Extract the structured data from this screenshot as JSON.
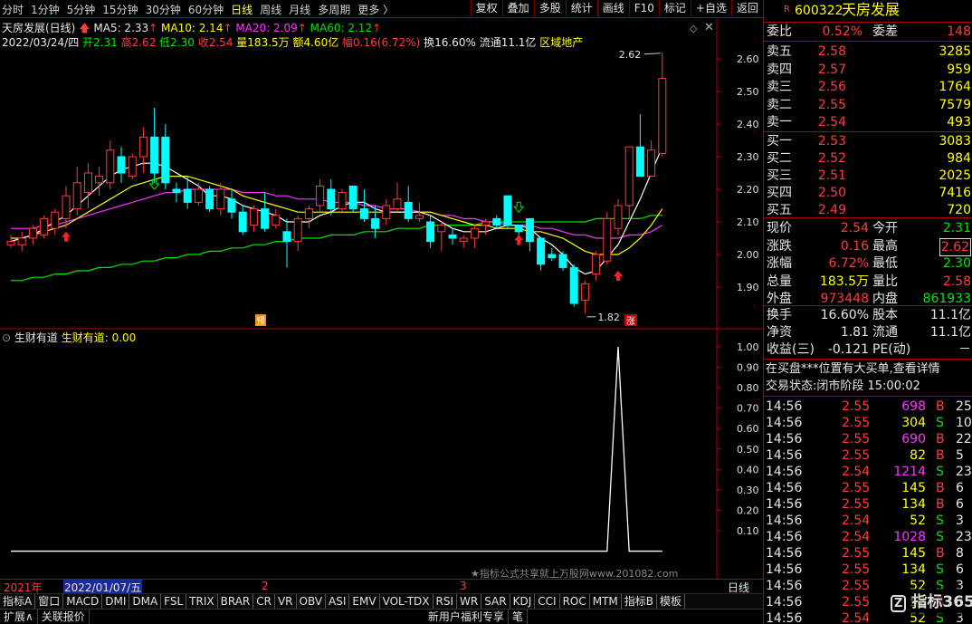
{
  "periods": [
    "分时",
    "1分钟",
    "5分钟",
    "15分钟",
    "30分钟",
    "60分钟",
    "日线",
    "周线",
    "月线",
    "多周期",
    "更多 〉"
  ],
  "toolbar": [
    "复权",
    "叠加",
    "多股",
    "统计",
    "画线",
    "F10",
    "标记",
    "+自选",
    "返回"
  ],
  "stock": {
    "code": "600322",
    "name": "天房发展",
    "badge": "R"
  },
  "legend": {
    "title": "天房发展(日线)",
    "ma5": "MA5: 2.33",
    "ma10": "MA10: 2.14",
    "ma20": "MA20: 2.09",
    "ma60": "MA60: 2.12"
  },
  "info_line": {
    "date": "2022/03/24/四",
    "open": "开2.31",
    "high": "高2.62",
    "low": "低2.30",
    "close": "收2.54",
    "vol": "量183.5万",
    "amt": "额4.60亿",
    "pct": "幅0.16(6.72%)",
    "turnover": "换16.60%",
    "float": "流通11.1亿",
    "sector": "区域地产"
  },
  "indicator": {
    "name": "生财有道",
    "value_label": "生财有道: 0.00",
    "expand_icon": "expand-icon"
  },
  "annotations": {
    "high": "2.62",
    "low": "1.82",
    "pre_mark": "预",
    "up_mark": "涨"
  },
  "time_axis": {
    "year": "2021年",
    "date": "2022/01/07/五",
    "m2": "2",
    "m3": "3",
    "period": "日线"
  },
  "watermark": "★指标公式共享就上万股网www.201082.com",
  "colors": {
    "up": "#ff3b3b",
    "down": "#00ffff",
    "ma5": "#ffffff",
    "ma10": "#ffff00",
    "ma20": "#ff33ff",
    "ma60": "#00e600",
    "grid": "#b00000"
  },
  "chart_data": [
    {
      "type": "candlestick",
      "title": "天房发展(日线)",
      "y_ticks": [
        1.9,
        2.0,
        2.1,
        2.2,
        2.3,
        2.4,
        2.5,
        2.6
      ],
      "ylim": [
        1.82,
        2.66
      ],
      "candles": [
        {
          "o": 2.03,
          "h": 2.06,
          "l": 2.02,
          "c": 2.04
        },
        {
          "o": 2.03,
          "h": 2.07,
          "l": 2.01,
          "c": 2.05
        },
        {
          "o": 2.05,
          "h": 2.09,
          "l": 2.03,
          "c": 2.08
        },
        {
          "o": 2.06,
          "h": 2.12,
          "l": 2.05,
          "c": 2.11
        },
        {
          "o": 2.08,
          "h": 2.14,
          "l": 2.06,
          "c": 2.13
        },
        {
          "o": 2.11,
          "h": 2.21,
          "l": 2.08,
          "c": 2.18
        },
        {
          "o": 2.14,
          "h": 2.27,
          "l": 2.12,
          "c": 2.22
        },
        {
          "o": 2.19,
          "h": 2.28,
          "l": 2.14,
          "c": 2.25
        },
        {
          "o": 2.22,
          "h": 2.27,
          "l": 2.18,
          "c": 2.24
        },
        {
          "o": 2.22,
          "h": 2.35,
          "l": 2.2,
          "c": 2.32
        },
        {
          "o": 2.3,
          "h": 2.33,
          "l": 2.22,
          "c": 2.25
        },
        {
          "o": 2.24,
          "h": 2.31,
          "l": 2.23,
          "c": 2.3
        },
        {
          "o": 2.3,
          "h": 2.39,
          "l": 2.25,
          "c": 2.36
        },
        {
          "o": 2.36,
          "h": 2.45,
          "l": 2.22,
          "c": 2.25
        },
        {
          "o": 2.36,
          "h": 2.4,
          "l": 2.2,
          "c": 2.22
        },
        {
          "o": 2.2,
          "h": 2.22,
          "l": 2.16,
          "c": 2.19
        },
        {
          "o": 2.2,
          "h": 2.24,
          "l": 2.14,
          "c": 2.16
        },
        {
          "o": 2.16,
          "h": 2.22,
          "l": 2.15,
          "c": 2.2
        },
        {
          "o": 2.2,
          "h": 2.21,
          "l": 2.13,
          "c": 2.14
        },
        {
          "o": 2.14,
          "h": 2.22,
          "l": 2.12,
          "c": 2.2
        },
        {
          "o": 2.17,
          "h": 2.2,
          "l": 2.11,
          "c": 2.13
        },
        {
          "o": 2.13,
          "h": 2.15,
          "l": 2.06,
          "c": 2.07
        },
        {
          "o": 2.09,
          "h": 2.15,
          "l": 2.07,
          "c": 2.14
        },
        {
          "o": 2.14,
          "h": 2.19,
          "l": 2.07,
          "c": 2.08
        },
        {
          "o": 2.09,
          "h": 2.14,
          "l": 2.08,
          "c": 2.12
        },
        {
          "o": 2.07,
          "h": 2.11,
          "l": 1.96,
          "c": 2.04
        },
        {
          "o": 2.04,
          "h": 2.12,
          "l": 2.01,
          "c": 2.11
        },
        {
          "o": 2.11,
          "h": 2.15,
          "l": 2.08,
          "c": 2.14
        },
        {
          "o": 2.15,
          "h": 2.23,
          "l": 2.13,
          "c": 2.21
        },
        {
          "o": 2.2,
          "h": 2.23,
          "l": 2.12,
          "c": 2.14
        },
        {
          "o": 2.14,
          "h": 2.2,
          "l": 2.13,
          "c": 2.19
        },
        {
          "o": 2.21,
          "h": 2.21,
          "l": 2.13,
          "c": 2.14
        },
        {
          "o": 2.14,
          "h": 2.2,
          "l": 2.1,
          "c": 2.11
        },
        {
          "o": 2.11,
          "h": 2.15,
          "l": 2.05,
          "c": 2.08
        },
        {
          "o": 2.11,
          "h": 2.17,
          "l": 2.09,
          "c": 2.15
        },
        {
          "o": 2.14,
          "h": 2.22,
          "l": 2.13,
          "c": 2.17
        },
        {
          "o": 2.16,
          "h": 2.21,
          "l": 2.1,
          "c": 2.11
        },
        {
          "o": 2.11,
          "h": 2.16,
          "l": 2.1,
          "c": 2.12
        },
        {
          "o": 2.1,
          "h": 2.12,
          "l": 2.02,
          "c": 2.04
        },
        {
          "o": 2.07,
          "h": 2.1,
          "l": 2.01,
          "c": 2.09
        },
        {
          "o": 2.06,
          "h": 2.08,
          "l": 2.03,
          "c": 2.05
        },
        {
          "o": 2.04,
          "h": 2.06,
          "l": 2.02,
          "c": 2.05
        },
        {
          "o": 2.05,
          "h": 2.09,
          "l": 2.02,
          "c": 2.08
        },
        {
          "o": 2.09,
          "h": 2.11,
          "l": 2.06,
          "c": 2.1
        },
        {
          "o": 2.11,
          "h": 2.12,
          "l": 2.08,
          "c": 2.09
        },
        {
          "o": 2.18,
          "h": 2.18,
          "l": 2.08,
          "c": 2.09
        },
        {
          "o": 2.09,
          "h": 2.09,
          "l": 2.05,
          "c": 2.07
        },
        {
          "o": 2.11,
          "h": 2.11,
          "l": 2.01,
          "c": 2.04
        },
        {
          "o": 2.05,
          "h": 2.05,
          "l": 1.95,
          "c": 1.97
        },
        {
          "o": 2.0,
          "h": 2.02,
          "l": 1.98,
          "c": 1.99
        },
        {
          "o": 2.0,
          "h": 2.01,
          "l": 1.95,
          "c": 1.96
        },
        {
          "o": 1.96,
          "h": 1.97,
          "l": 1.84,
          "c": 1.85
        },
        {
          "o": 1.86,
          "h": 1.92,
          "l": 1.82,
          "c": 1.91
        },
        {
          "o": 1.94,
          "h": 2.01,
          "l": 1.92,
          "c": 2.0
        },
        {
          "o": 1.98,
          "h": 2.13,
          "l": 1.97,
          "c": 2.11
        },
        {
          "o": 2.08,
          "h": 2.17,
          "l": 2.06,
          "c": 2.15
        },
        {
          "o": 2.15,
          "h": 2.33,
          "l": 2.11,
          "c": 2.33
        },
        {
          "o": 2.33,
          "h": 2.43,
          "l": 2.25,
          "c": 2.24
        },
        {
          "o": 2.24,
          "h": 2.35,
          "l": 2.24,
          "c": 2.32
        },
        {
          "o": 2.31,
          "h": 2.62,
          "l": 2.3,
          "c": 2.54
        }
      ],
      "ma5": [
        2.04,
        2.05,
        2.06,
        2.08,
        2.1,
        2.12,
        2.15,
        2.18,
        2.21,
        2.24,
        2.26,
        2.27,
        2.28,
        2.28,
        2.27,
        2.25,
        2.23,
        2.21,
        2.18,
        2.18,
        2.17,
        2.15,
        2.14,
        2.13,
        2.12,
        2.1,
        2.1,
        2.1,
        2.12,
        2.13,
        2.15,
        2.16,
        2.16,
        2.14,
        2.13,
        2.13,
        2.13,
        2.13,
        2.12,
        2.1,
        2.08,
        2.07,
        2.07,
        2.07,
        2.08,
        2.09,
        2.09,
        2.08,
        2.05,
        2.03,
        2.0,
        1.96,
        1.94,
        1.95,
        1.99,
        2.03,
        2.1,
        2.17,
        2.25,
        2.33
      ],
      "ma10": [
        2.05,
        2.05,
        2.06,
        2.07,
        2.08,
        2.09,
        2.11,
        2.13,
        2.15,
        2.17,
        2.19,
        2.21,
        2.22,
        2.23,
        2.24,
        2.24,
        2.24,
        2.23,
        2.22,
        2.21,
        2.2,
        2.18,
        2.17,
        2.16,
        2.15,
        2.14,
        2.13,
        2.13,
        2.13,
        2.13,
        2.13,
        2.13,
        2.13,
        2.13,
        2.13,
        2.13,
        2.13,
        2.13,
        2.13,
        2.12,
        2.11,
        2.1,
        2.09,
        2.09,
        2.08,
        2.08,
        2.08,
        2.07,
        2.07,
        2.06,
        2.05,
        2.03,
        2.01,
        2.0,
        2.0,
        2.0,
        2.02,
        2.05,
        2.09,
        2.14
      ],
      "ma20": [
        2.08,
        2.08,
        2.08,
        2.09,
        2.09,
        2.1,
        2.11,
        2.12,
        2.13,
        2.14,
        2.15,
        2.16,
        2.17,
        2.18,
        2.19,
        2.19,
        2.2,
        2.2,
        2.2,
        2.2,
        2.2,
        2.19,
        2.19,
        2.19,
        2.18,
        2.18,
        2.17,
        2.17,
        2.17,
        2.16,
        2.16,
        2.16,
        2.15,
        2.15,
        2.14,
        2.14,
        2.14,
        2.13,
        2.13,
        2.12,
        2.12,
        2.11,
        2.11,
        2.1,
        2.1,
        2.09,
        2.09,
        2.09,
        2.08,
        2.08,
        2.07,
        2.06,
        2.06,
        2.05,
        2.05,
        2.05,
        2.06,
        2.06,
        2.07,
        2.09
      ],
      "ma60": [
        1.92,
        1.92,
        1.93,
        1.93,
        1.94,
        1.94,
        1.95,
        1.95,
        1.96,
        1.96,
        1.97,
        1.97,
        1.98,
        1.98,
        1.99,
        1.99,
        2.0,
        2.0,
        2.01,
        2.01,
        2.02,
        2.02,
        2.03,
        2.03,
        2.04,
        2.04,
        2.05,
        2.05,
        2.05,
        2.06,
        2.06,
        2.06,
        2.07,
        2.07,
        2.07,
        2.08,
        2.08,
        2.08,
        2.09,
        2.09,
        2.09,
        2.09,
        2.09,
        2.1,
        2.1,
        2.1,
        2.1,
        2.1,
        2.1,
        2.1,
        2.1,
        2.1,
        2.1,
        2.11,
        2.11,
        2.11,
        2.11,
        2.11,
        2.12,
        2.12
      ]
    },
    {
      "type": "line",
      "title": "生财有道",
      "y_ticks": [
        0.1,
        0.2,
        0.3,
        0.4,
        0.5,
        0.6,
        0.7,
        0.8,
        0.9,
        1.0
      ],
      "ylim": [
        -0.07,
        1.07
      ],
      "values": [
        0,
        0,
        0,
        0,
        0,
        0,
        0,
        0,
        0,
        0,
        0,
        0,
        0,
        0,
        0,
        0,
        0,
        0,
        0,
        0,
        0,
        0,
        0,
        0,
        0,
        0,
        0,
        0,
        0,
        0,
        0,
        0,
        0,
        0,
        0,
        0,
        0,
        0,
        0,
        0,
        0,
        0,
        0,
        0,
        0,
        0,
        0,
        0,
        0,
        0,
        0,
        0,
        0,
        0,
        0,
        1,
        0,
        0,
        0,
        0
      ]
    }
  ],
  "right": {
    "wb": {
      "l1": "委比",
      "v1": "0.52%",
      "l2": "委差",
      "v2": "148"
    },
    "asks": [
      {
        "l": "卖五",
        "p": "2.58",
        "v": "3285"
      },
      {
        "l": "卖四",
        "p": "2.57",
        "v": "959"
      },
      {
        "l": "卖三",
        "p": "2.56",
        "v": "1764"
      },
      {
        "l": "卖二",
        "p": "2.55",
        "v": "7579"
      },
      {
        "l": "卖一",
        "p": "2.54",
        "v": "493"
      }
    ],
    "bids": [
      {
        "l": "买一",
        "p": "2.53",
        "v": "3083"
      },
      {
        "l": "买二",
        "p": "2.52",
        "v": "984"
      },
      {
        "l": "买三",
        "p": "2.51",
        "v": "2025"
      },
      {
        "l": "买四",
        "p": "2.50",
        "v": "7416"
      },
      {
        "l": "买五",
        "p": "2.49",
        "v": "720"
      }
    ],
    "quote": [
      {
        "l1": "现价",
        "v1": "2.54",
        "l2": "今开",
        "v2": "2.31"
      },
      {
        "l1": "涨跌",
        "v1": "0.16",
        "l2": "最高",
        "v2": "2.62"
      },
      {
        "l1": "涨幅",
        "v1": "6.72%",
        "l2": "最低",
        "v2": "2.30"
      },
      {
        "l1": "总量",
        "v1": "183.5万",
        "l2": "量比",
        "v2": "2.58"
      },
      {
        "l1": "外盘",
        "v1": "973448",
        "l2": "内盘",
        "v2": "861933"
      }
    ],
    "stats": [
      {
        "l1": "换手",
        "v1": "16.60%",
        "l2": "股本",
        "v2": "11.1亿"
      },
      {
        "l1": "净资",
        "v1": "1.81",
        "l2": "流通",
        "v2": "11.1亿"
      },
      {
        "l1": "收益(三)",
        "v1": "-0.121",
        "l2": "PE(动)",
        "v2": "－"
      }
    ],
    "notice": "在买盘***位置有大买单,查看详情",
    "trade_status": "交易状态:闭市阶段 15:00:02",
    "ticks": [
      {
        "t": "14:56",
        "p": "2.55",
        "v": "698",
        "d": "B",
        "n": "25"
      },
      {
        "t": "14:56",
        "p": "2.55",
        "v": "304",
        "d": "S",
        "n": "10"
      },
      {
        "t": "14:56",
        "p": "2.55",
        "v": "690",
        "d": "B",
        "n": "22"
      },
      {
        "t": "14:56",
        "p": "2.55",
        "v": "82",
        "d": "B",
        "n": "5"
      },
      {
        "t": "14:56",
        "p": "2.54",
        "v": "1214",
        "d": "S",
        "n": "23"
      },
      {
        "t": "14:56",
        "p": "2.55",
        "v": "145",
        "d": "B",
        "n": "6"
      },
      {
        "t": "14:56",
        "p": "2.55",
        "v": "134",
        "d": "B",
        "n": "6"
      },
      {
        "t": "14:56",
        "p": "2.54",
        "v": "52",
        "d": "S",
        "n": "3"
      },
      {
        "t": "14:56",
        "p": "2.54",
        "v": "1028",
        "d": "S",
        "n": "23"
      },
      {
        "t": "14:56",
        "p": "2.55",
        "v": "145",
        "d": "B",
        "n": "8"
      },
      {
        "t": "14:56",
        "p": "2.55",
        "v": "134",
        "d": "S",
        "n": "6"
      },
      {
        "t": "14:56",
        "p": "2.55",
        "v": "52",
        "d": "S",
        "n": "3"
      },
      {
        "t": "14:56",
        "p": "2.55",
        "v": "52",
        "d": "B",
        "n": "3"
      },
      {
        "t": "14:56",
        "p": "2.54",
        "v": "52",
        "d": "S",
        "n": "3"
      }
    ],
    "logo": "指标365"
  },
  "tabs": [
    "指标A",
    "窗口",
    "MACD",
    "DMI",
    "DMA",
    "FSL",
    "TRIX",
    "BRAR",
    "CR",
    "VR",
    "OBV",
    "ASI",
    "EMV",
    "VOL-TDX",
    "RSI",
    "WR",
    "SAR",
    "KDJ",
    "CCI",
    "ROC",
    "MTM",
    "指标B",
    "模板"
  ],
  "bottom": [
    "扩展∧",
    "关联报价",
    "新用户福利专享",
    "笔"
  ]
}
